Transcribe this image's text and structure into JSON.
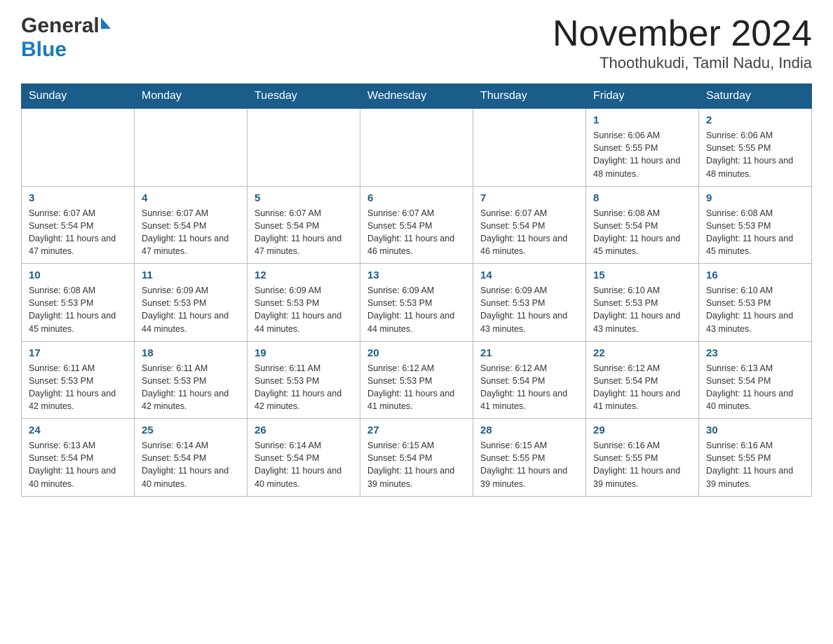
{
  "header": {
    "logo_general": "General",
    "logo_blue": "Blue",
    "month_title": "November 2024",
    "location": "Thoothukudi, Tamil Nadu, India"
  },
  "weekdays": [
    "Sunday",
    "Monday",
    "Tuesday",
    "Wednesday",
    "Thursday",
    "Friday",
    "Saturday"
  ],
  "weeks": [
    [
      {
        "day": "",
        "info": ""
      },
      {
        "day": "",
        "info": ""
      },
      {
        "day": "",
        "info": ""
      },
      {
        "day": "",
        "info": ""
      },
      {
        "day": "",
        "info": ""
      },
      {
        "day": "1",
        "info": "Sunrise: 6:06 AM\nSunset: 5:55 PM\nDaylight: 11 hours and 48 minutes."
      },
      {
        "day": "2",
        "info": "Sunrise: 6:06 AM\nSunset: 5:55 PM\nDaylight: 11 hours and 48 minutes."
      }
    ],
    [
      {
        "day": "3",
        "info": "Sunrise: 6:07 AM\nSunset: 5:54 PM\nDaylight: 11 hours and 47 minutes."
      },
      {
        "day": "4",
        "info": "Sunrise: 6:07 AM\nSunset: 5:54 PM\nDaylight: 11 hours and 47 minutes."
      },
      {
        "day": "5",
        "info": "Sunrise: 6:07 AM\nSunset: 5:54 PM\nDaylight: 11 hours and 47 minutes."
      },
      {
        "day": "6",
        "info": "Sunrise: 6:07 AM\nSunset: 5:54 PM\nDaylight: 11 hours and 46 minutes."
      },
      {
        "day": "7",
        "info": "Sunrise: 6:07 AM\nSunset: 5:54 PM\nDaylight: 11 hours and 46 minutes."
      },
      {
        "day": "8",
        "info": "Sunrise: 6:08 AM\nSunset: 5:54 PM\nDaylight: 11 hours and 45 minutes."
      },
      {
        "day": "9",
        "info": "Sunrise: 6:08 AM\nSunset: 5:53 PM\nDaylight: 11 hours and 45 minutes."
      }
    ],
    [
      {
        "day": "10",
        "info": "Sunrise: 6:08 AM\nSunset: 5:53 PM\nDaylight: 11 hours and 45 minutes."
      },
      {
        "day": "11",
        "info": "Sunrise: 6:09 AM\nSunset: 5:53 PM\nDaylight: 11 hours and 44 minutes."
      },
      {
        "day": "12",
        "info": "Sunrise: 6:09 AM\nSunset: 5:53 PM\nDaylight: 11 hours and 44 minutes."
      },
      {
        "day": "13",
        "info": "Sunrise: 6:09 AM\nSunset: 5:53 PM\nDaylight: 11 hours and 44 minutes."
      },
      {
        "day": "14",
        "info": "Sunrise: 6:09 AM\nSunset: 5:53 PM\nDaylight: 11 hours and 43 minutes."
      },
      {
        "day": "15",
        "info": "Sunrise: 6:10 AM\nSunset: 5:53 PM\nDaylight: 11 hours and 43 minutes."
      },
      {
        "day": "16",
        "info": "Sunrise: 6:10 AM\nSunset: 5:53 PM\nDaylight: 11 hours and 43 minutes."
      }
    ],
    [
      {
        "day": "17",
        "info": "Sunrise: 6:11 AM\nSunset: 5:53 PM\nDaylight: 11 hours and 42 minutes."
      },
      {
        "day": "18",
        "info": "Sunrise: 6:11 AM\nSunset: 5:53 PM\nDaylight: 11 hours and 42 minutes."
      },
      {
        "day": "19",
        "info": "Sunrise: 6:11 AM\nSunset: 5:53 PM\nDaylight: 11 hours and 42 minutes."
      },
      {
        "day": "20",
        "info": "Sunrise: 6:12 AM\nSunset: 5:53 PM\nDaylight: 11 hours and 41 minutes."
      },
      {
        "day": "21",
        "info": "Sunrise: 6:12 AM\nSunset: 5:54 PM\nDaylight: 11 hours and 41 minutes."
      },
      {
        "day": "22",
        "info": "Sunrise: 6:12 AM\nSunset: 5:54 PM\nDaylight: 11 hours and 41 minutes."
      },
      {
        "day": "23",
        "info": "Sunrise: 6:13 AM\nSunset: 5:54 PM\nDaylight: 11 hours and 40 minutes."
      }
    ],
    [
      {
        "day": "24",
        "info": "Sunrise: 6:13 AM\nSunset: 5:54 PM\nDaylight: 11 hours and 40 minutes."
      },
      {
        "day": "25",
        "info": "Sunrise: 6:14 AM\nSunset: 5:54 PM\nDaylight: 11 hours and 40 minutes."
      },
      {
        "day": "26",
        "info": "Sunrise: 6:14 AM\nSunset: 5:54 PM\nDaylight: 11 hours and 40 minutes."
      },
      {
        "day": "27",
        "info": "Sunrise: 6:15 AM\nSunset: 5:54 PM\nDaylight: 11 hours and 39 minutes."
      },
      {
        "day": "28",
        "info": "Sunrise: 6:15 AM\nSunset: 5:55 PM\nDaylight: 11 hours and 39 minutes."
      },
      {
        "day": "29",
        "info": "Sunrise: 6:16 AM\nSunset: 5:55 PM\nDaylight: 11 hours and 39 minutes."
      },
      {
        "day": "30",
        "info": "Sunrise: 6:16 AM\nSunset: 5:55 PM\nDaylight: 11 hours and 39 minutes."
      }
    ]
  ]
}
